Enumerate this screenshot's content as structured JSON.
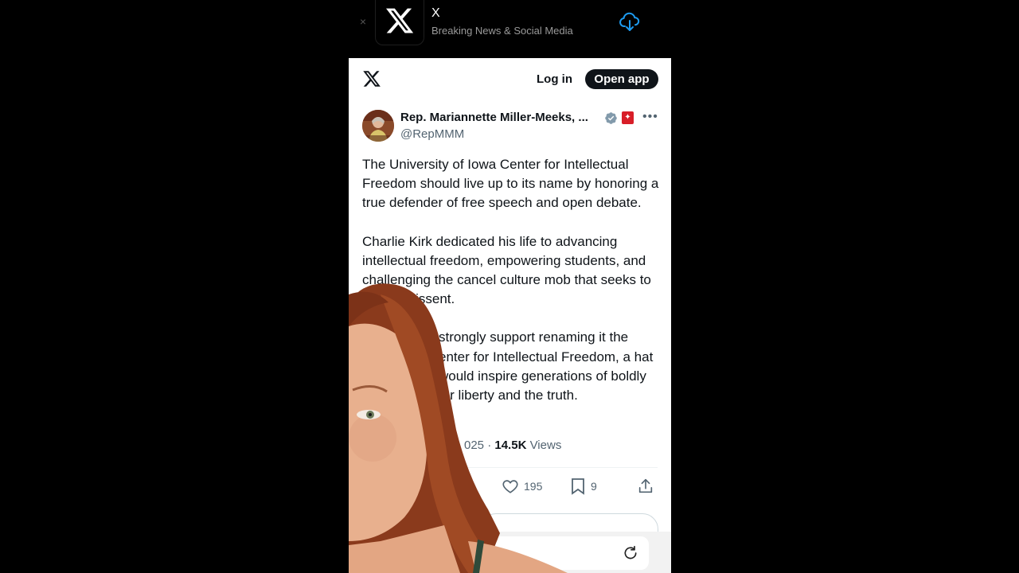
{
  "banner": {
    "close_label": "×",
    "app_name": "X",
    "app_subtitle": "Breaking News & Social Media",
    "icon": "cloud-download-icon"
  },
  "header": {
    "logo": "x-logo-icon",
    "login_label": "Log in",
    "open_app_label": "Open app"
  },
  "tweet": {
    "author_name": "Rep. Mariannette Miller-Meeks, ...",
    "handle": "@RepMMM",
    "paragraphs": [
      "The University of Iowa Center for Intellectual Freedom should live up to its name by honoring a true defender of free speech and open debate.",
      "Charlie Kirk dedicated his life to advancing intellectual freedom, empowering students, and challenging the cancel culture mob that seeks to silence dissent.",
      "strongly support renaming it the enter for Intellectual Freedom, a hat would inspire generations of boldly for liberty and the truth."
    ],
    "date_fragment": "025 ·",
    "views_count": "14.5K",
    "views_label": "Views",
    "likes": "195",
    "bookmarks": "9"
  },
  "colors": {
    "accent_blue": "#1d9bf0",
    "text_primary": "#0f1419",
    "text_secondary": "#536471",
    "gov_badge_red": "#d81e28"
  }
}
